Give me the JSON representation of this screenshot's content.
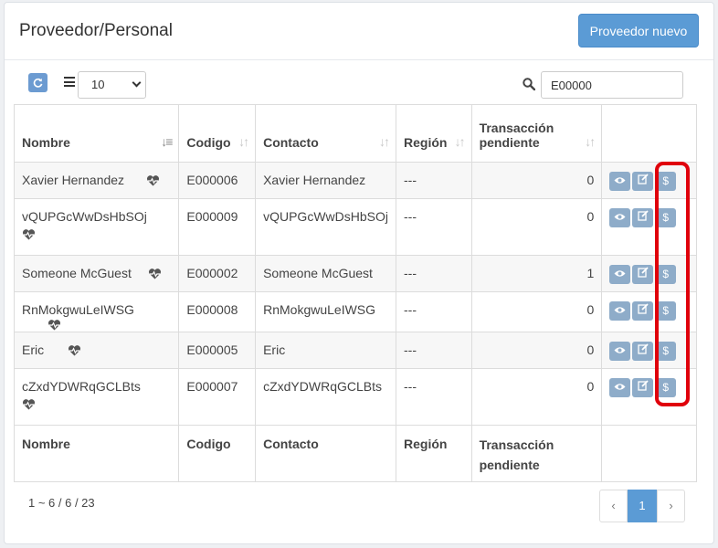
{
  "panel": {
    "title": "Proveedor/Personal",
    "new_button": "Proveedor nuevo"
  },
  "toolbar": {
    "refresh_icon": "refresh-icon",
    "page_size": "10",
    "search_value": "E00000"
  },
  "columns": [
    "Nombre",
    "Codigo",
    "Contacto",
    "Región",
    "Transacción pendiente"
  ],
  "rows": [
    {
      "name": "Xavier Hernandez",
      "code": "E000006",
      "contact": "Xavier Hernandez",
      "region": "---",
      "pending": "0"
    },
    {
      "name": "vQUPGcWwDsHbSOj",
      "code": "E000009",
      "contact": "vQUPGcWwDsHbSOj",
      "region": "---",
      "pending": "0"
    },
    {
      "name": "Someone McGuest",
      "code": "E000002",
      "contact": "Someone McGuest",
      "region": "---",
      "pending": "1"
    },
    {
      "name": "RnMokgwuLeIWSG",
      "code": "E000008",
      "contact": "RnMokgwuLeIWSG",
      "region": "---",
      "pending": "0"
    },
    {
      "name": "Eric",
      "code": "E000005",
      "contact": "Eric",
      "region": "---",
      "pending": "0"
    },
    {
      "name": "cZxdYDWRqGCLBts",
      "code": "E000007",
      "contact": "cZxdYDWRqGCLBts",
      "region": "---",
      "pending": "0"
    }
  ],
  "footer": {
    "range": "1 ~ 6 / 6 / 23"
  },
  "pager": {
    "prev": "‹",
    "current": "1",
    "next": "›"
  },
  "colors": {
    "primary": "#5b9bd5",
    "action_button": "#8eacc9",
    "highlight": "#e0000b"
  }
}
